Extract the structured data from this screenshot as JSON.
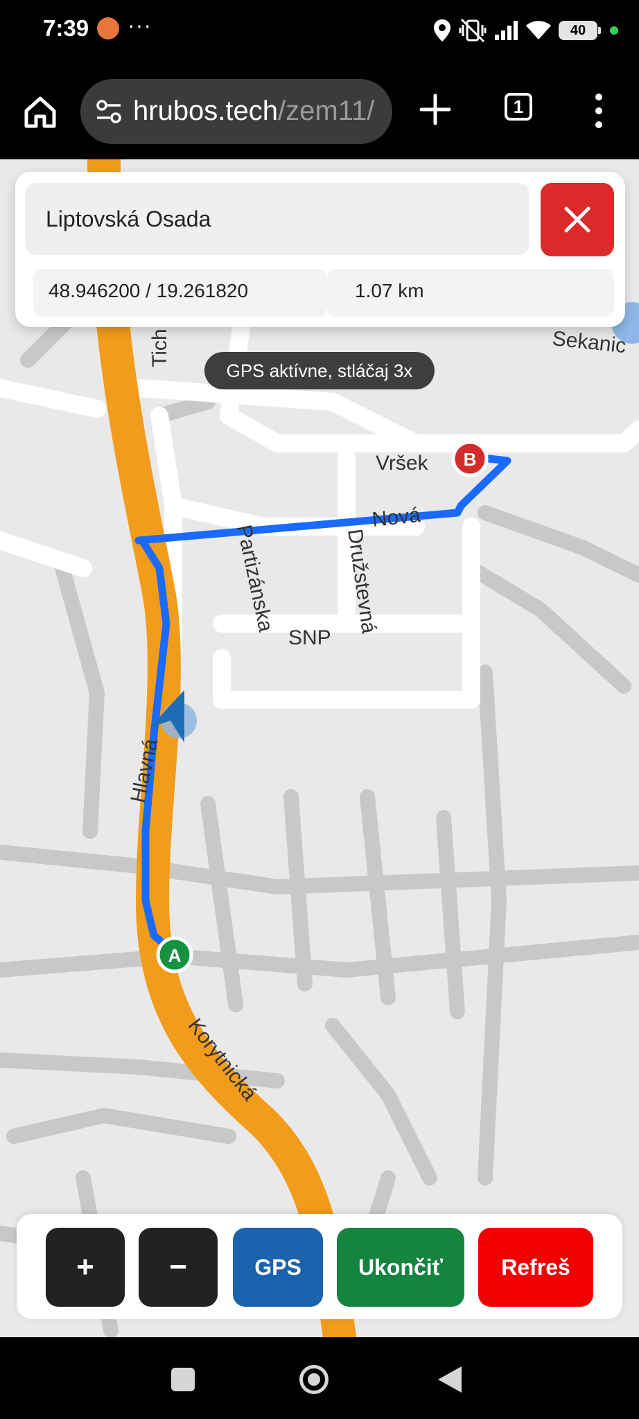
{
  "status_bar": {
    "time": "7:39",
    "more": "···",
    "battery": "40"
  },
  "browser": {
    "url_host": "hrubos.tech",
    "url_path": "/zem11/",
    "tab_count": "1"
  },
  "search": {
    "value": "Liptovská Osada",
    "coords": "48.946200 / 19.261820",
    "distance": "1.07 km"
  },
  "toast": {
    "text": "GPS aktívne, stláčaj 3x"
  },
  "map": {
    "streets": [
      "Tich",
      "Sekanic",
      "Vršek",
      "Nová",
      "Partizánska",
      "Družstevná",
      "SNP",
      "Hlavná",
      "Korytnická"
    ],
    "markers": {
      "start": "A",
      "end": "B"
    },
    "colors": {
      "route": "#1a6aff",
      "main_road": "#f29c1c",
      "roads": "#ffffff",
      "minor_roads": "#c8c8c8"
    }
  },
  "controls": {
    "zoom_in": "+",
    "zoom_out": "−",
    "gps": "GPS",
    "end": "Ukončiť",
    "refresh": "Refreš"
  }
}
